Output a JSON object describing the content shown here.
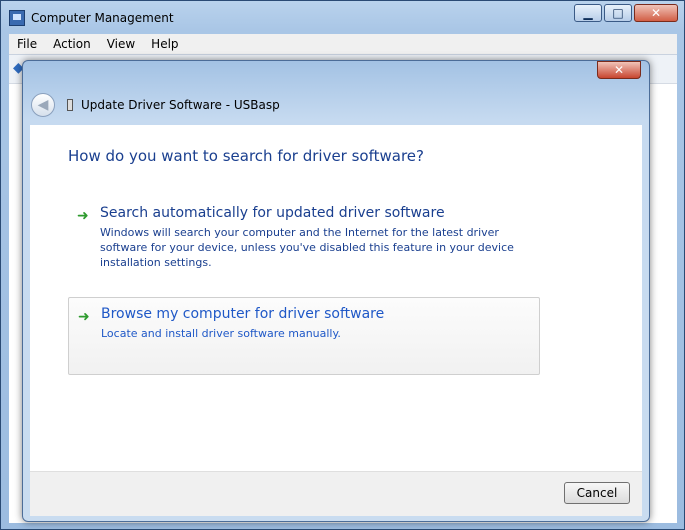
{
  "outer_window": {
    "title": "Computer Management",
    "icon": "computer-management-icon",
    "controls": {
      "minimize": "▁",
      "maximize": "□",
      "close": "✕"
    }
  },
  "menubar": {
    "items": [
      {
        "label": "File"
      },
      {
        "label": "Action"
      },
      {
        "label": "View"
      },
      {
        "label": "Help"
      }
    ]
  },
  "dialog": {
    "title": "Update Driver Software - USBasp",
    "close_glyph": "✕",
    "back_glyph": "◀",
    "question": "How do you want to search for driver software?",
    "options": [
      {
        "title": "Search automatically for updated driver software",
        "description": "Windows will search your computer and the Internet for the latest driver software for your device, unless you've disabled this feature in your device installation settings.",
        "icon": "green-arrow-icon"
      },
      {
        "title": "Browse my computer for driver software",
        "description": "Locate and install driver software manually.",
        "icon": "green-arrow-icon"
      }
    ],
    "cancel_label": "Cancel"
  },
  "colors": {
    "link_blue": "#1a3f8f",
    "highlight_blue": "#1f58c7",
    "arrow_green": "#2e9b2e"
  }
}
